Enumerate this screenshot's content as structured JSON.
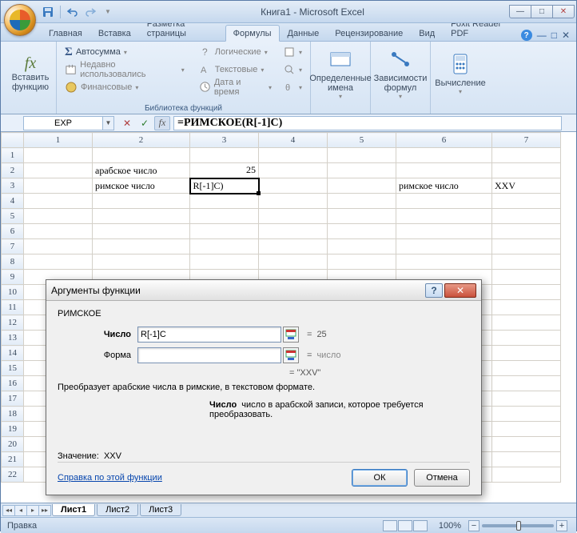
{
  "title": "Книга1 - Microsoft Excel",
  "tabs": [
    "Главная",
    "Вставка",
    "Разметка страницы",
    "Формулы",
    "Данные",
    "Рецензирование",
    "Вид",
    "Foxit Reader PDF"
  ],
  "active_tab_index": 3,
  "ribbon": {
    "insert_fn": "Вставить\nфункцию",
    "lib": {
      "autosum": "Автосумма",
      "recent": "Недавно использовались",
      "financial": "Финансовые",
      "logical": "Логические",
      "text": "Текстовые",
      "datetime": "Дата и время",
      "title": "Библиотека функций"
    },
    "names": "Определенные\nимена",
    "deps": "Зависимости\nформул",
    "calc": "Вычисление"
  },
  "namebox": "EXP",
  "formula": "=РИМСКОЕ(R[-1]C)",
  "columns": [
    "1",
    "2",
    "3",
    "4",
    "5",
    "6",
    "7"
  ],
  "cells": {
    "r2c2": "арабское число",
    "r2c3": "25",
    "r3c2": "римское число",
    "r3c3": "R[-1]C)",
    "r3c6": "римское число",
    "r3c7": "XXV"
  },
  "sheets": [
    "Лист1",
    "Лист2",
    "Лист3"
  ],
  "status": "Правка",
  "zoom": "100%",
  "dialog": {
    "title": "Аргументы функции",
    "fn_name": "РИМСКОЕ",
    "arg1_label": "Число",
    "arg1_value": "R[-1]C",
    "arg1_eval": "25",
    "arg2_label": "Форма",
    "arg2_value": "",
    "arg2_eval": "число",
    "result_preview": "\"XXV\"",
    "desc": "Преобразует арабские числа в римские, в текстовом формате.",
    "arg_desc_label": "Число",
    "arg_desc_text": "число в арабской записи, которое требуется преобразовать.",
    "value_label": "Значение:",
    "value": "XXV",
    "help_link": "Справка по этой функции",
    "ok": "ОК",
    "cancel": "Отмена"
  }
}
